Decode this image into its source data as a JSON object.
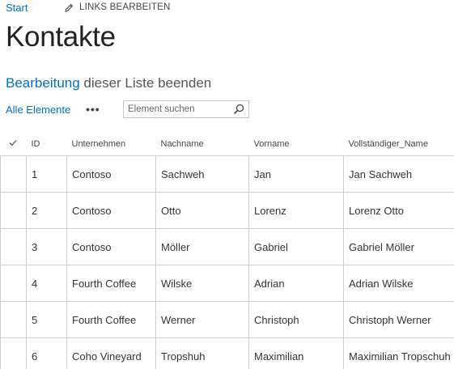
{
  "nav": {
    "start_label": "Start",
    "edit_links_label": "LINKS BEARBEITEN"
  },
  "page": {
    "title": "Kontakte"
  },
  "edit_mode": {
    "link_text": "Bearbeitung",
    "rest_text": " dieser Liste beenden"
  },
  "toolbar": {
    "view_label": "Alle Elemente",
    "more_label": "•••",
    "search_placeholder": "Element suchen"
  },
  "table": {
    "columns": [
      "ID",
      "Unternehmen",
      "Nachname",
      "Vorname",
      "Vollständiger_Name"
    ],
    "rows": [
      [
        "1",
        "Contoso",
        "Sachweh",
        "Jan",
        "Jan Sachweh"
      ],
      [
        "2",
        "Contoso",
        "Otto",
        "Lorenz",
        "Lorenz Otto"
      ],
      [
        "3",
        "Contoso",
        "Möller",
        "Gabriel",
        "Gabriel Möller"
      ],
      [
        "4",
        "Fourth Coffee",
        "Wilske",
        "Adrian",
        "Adrian Wilske"
      ],
      [
        "5",
        "Fourth Coffee",
        "Werner",
        "Christoph",
        "Christoph Werner"
      ],
      [
        "6",
        "Coho Vineyard",
        "Tropshuh",
        "Maximilian",
        "Maximilian Tropschuh"
      ]
    ]
  },
  "colors": {
    "link": "#0072c6",
    "border": "#cfcfcf"
  },
  "icons": {
    "edit": "pencil-icon",
    "search": "search-icon",
    "select_all": "checkmark-icon"
  }
}
